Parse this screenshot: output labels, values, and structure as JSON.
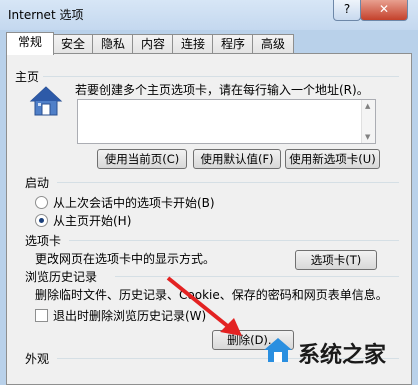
{
  "window": {
    "title": "Internet 选项",
    "help_label": "?",
    "close_label": "✕"
  },
  "tabs": [
    "常规",
    "安全",
    "隐私",
    "内容",
    "连接",
    "程序",
    "高级"
  ],
  "homepage": {
    "section_label": "主页",
    "instruction": "若要创建多个主页选项卡，请在每行输入一个地址(R)。",
    "address_value": "",
    "buttons": [
      "使用当前页(C)",
      "使用默认值(F)",
      "使用新选项卡(U)"
    ]
  },
  "startup": {
    "section_label": "启动",
    "options": [
      "从上次会话中的选项卡开始(B)",
      "从主页开始(H)"
    ],
    "selected_index": 1
  },
  "tabs_section": {
    "section_label": "选项卡",
    "description": "更改网页在选项卡中的显示方式。",
    "button": "选项卡(T)"
  },
  "history": {
    "section_label": "浏览历史记录",
    "description": "删除临时文件、历史记录、Cookie、保存的密码和网页表单信息。",
    "checkbox_label": "退出时删除浏览历史记录(W)",
    "checkbox_checked": false,
    "delete_button": "删除(D)..."
  },
  "appearance": {
    "section_label": "外观"
  },
  "watermark": {
    "text": "系统之家"
  }
}
